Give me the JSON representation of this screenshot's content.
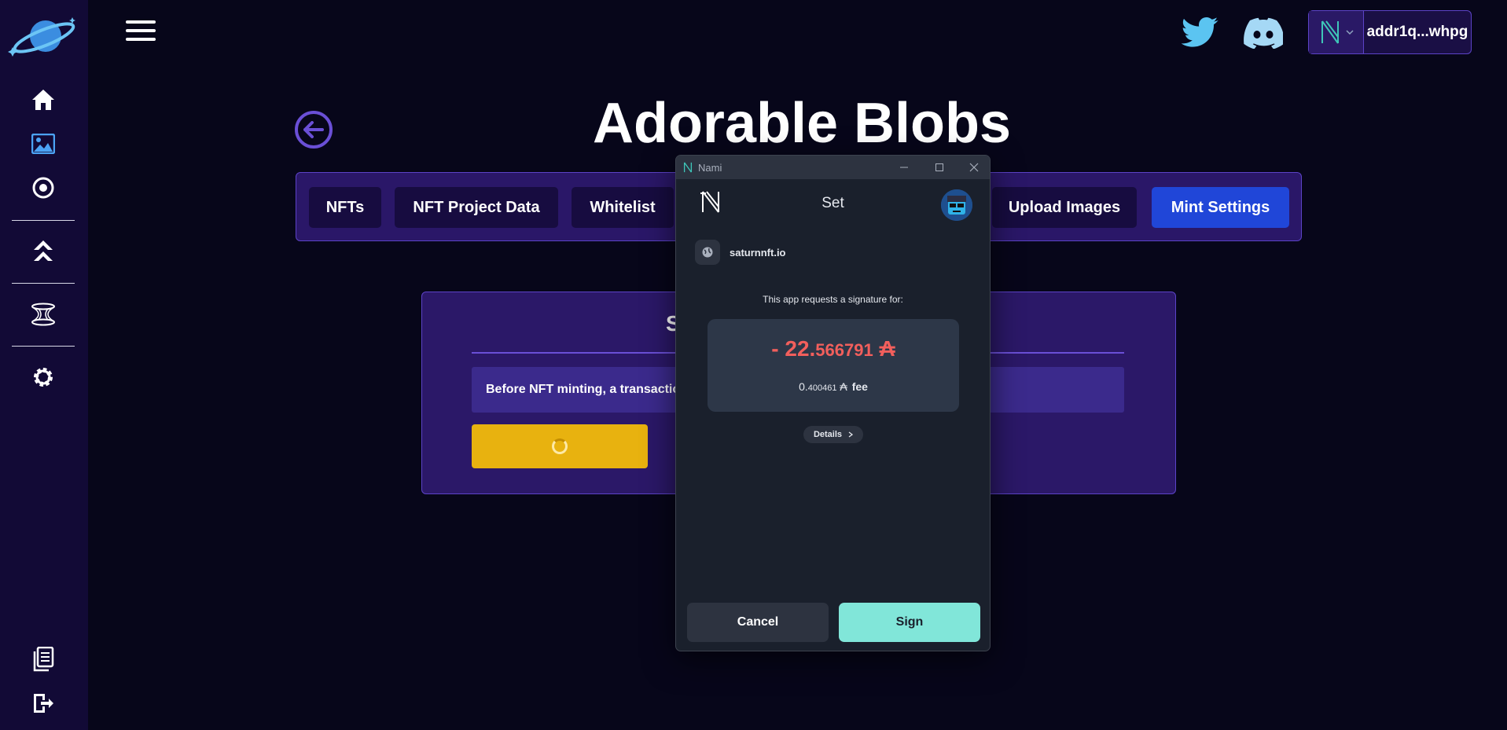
{
  "sidebar": {
    "items": [
      {
        "icon": "home-icon"
      },
      {
        "icon": "image-icon",
        "color": "#4ba3f5"
      },
      {
        "icon": "target-icon"
      },
      {
        "icon": "chevrons-up-icon"
      },
      {
        "icon": "cable-icon"
      },
      {
        "icon": "gear-icon"
      },
      {
        "icon": "document-icon"
      },
      {
        "icon": "logout-icon"
      }
    ]
  },
  "header": {
    "wallet_address": "addr1q...whpg",
    "social": [
      "twitter-icon",
      "discord-icon"
    ]
  },
  "main": {
    "title": "Adorable Blobs",
    "tabs": [
      {
        "label": "NFTs"
      },
      {
        "label": "NFT Project Data"
      },
      {
        "label": "Whitelist"
      },
      {
        "label": "Upload Images"
      },
      {
        "label": "Mint Settings",
        "active": true
      }
    ],
    "card": {
      "title_visible": "S",
      "info": "Before NFT minting, a transactio"
    }
  },
  "popup": {
    "window_title": "Nami",
    "header_title": "Set",
    "origin": "saturnnft.io",
    "request_text": "This app requests a signature for:",
    "amount_main": "- 22.",
    "amount_decimal": "566791",
    "currency_symbol": "₳",
    "fee_int": "0.",
    "fee_decimal": "400461",
    "fee_label": "fee",
    "details_label": "Details",
    "cancel_label": "Cancel",
    "sign_label": "Sign"
  },
  "colors": {
    "background": "#07061a",
    "sidebar": "#120a36",
    "panel": "#2b1868",
    "accent_border": "#5c43c7",
    "active_tab": "#2046d8",
    "yellow_button": "#e8b20f",
    "twitter": "#5bc4f1",
    "nami_amount": "#f25f5c",
    "sign_button": "#81e6d9"
  }
}
